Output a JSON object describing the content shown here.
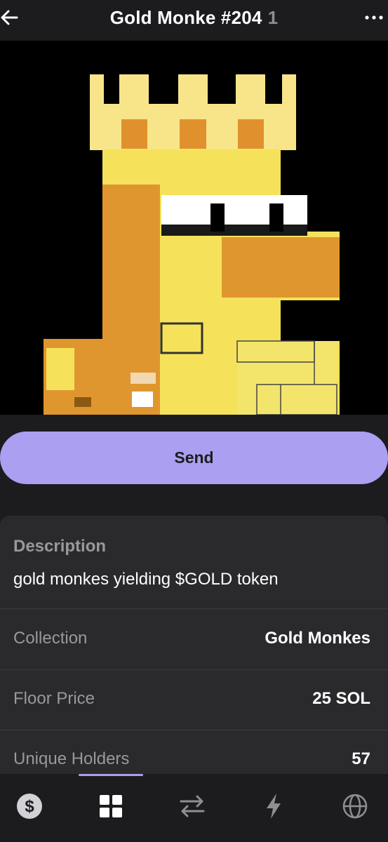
{
  "header": {
    "title": "Gold Monke #204",
    "count": "1"
  },
  "nft": {
    "image_icon": "pixel-gold-monke-crown-image"
  },
  "actions": {
    "send_label": "Send"
  },
  "description": {
    "label": "Description",
    "text": "gold monkes yielding $GOLD token"
  },
  "attributes": [
    {
      "label": "Collection",
      "value": "Gold Monkes"
    },
    {
      "label": "Floor Price",
      "value": "25 SOL"
    },
    {
      "label": "Unique Holders",
      "value": "57"
    }
  ],
  "tabbar": {
    "items": [
      "dollar-icon",
      "grid-icon",
      "swap-icon",
      "lightning-icon",
      "globe-icon"
    ],
    "active": "grid-icon"
  },
  "colors": {
    "accent": "#ab9ff2",
    "background": "#1c1c1e",
    "card": "#2a2a2c"
  }
}
